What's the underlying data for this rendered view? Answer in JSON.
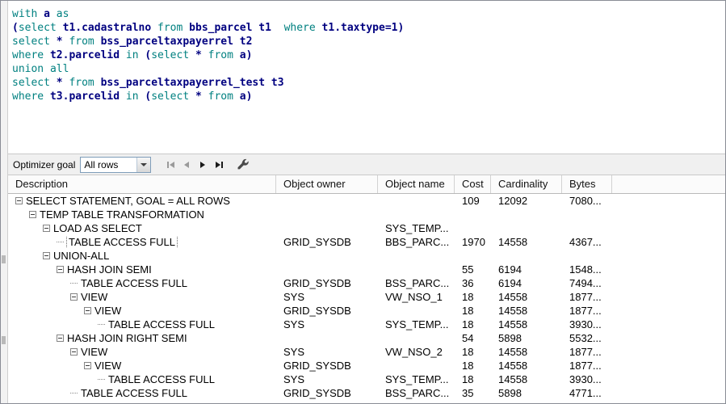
{
  "editor": {
    "lines": [
      [
        {
          "t": "with ",
          "k": "kw"
        },
        {
          "t": "a ",
          "k": "id"
        },
        {
          "t": "as",
          "k": "kw"
        }
      ],
      [
        {
          "t": "(",
          "k": "id"
        },
        {
          "t": "select ",
          "k": "kw"
        },
        {
          "t": "t1.cadastralno ",
          "k": "id"
        },
        {
          "t": "from ",
          "k": "kw"
        },
        {
          "t": "bbs_parcel t1  ",
          "k": "id"
        },
        {
          "t": "where ",
          "k": "kw"
        },
        {
          "t": "t1.taxtype=1)",
          "k": "id"
        }
      ],
      [
        {
          "t": "select ",
          "k": "kw"
        },
        {
          "t": "* ",
          "k": "id"
        },
        {
          "t": "from ",
          "k": "kw"
        },
        {
          "t": "bss_parceltaxpayerrel t2",
          "k": "id"
        }
      ],
      [
        {
          "t": "where ",
          "k": "kw"
        },
        {
          "t": "t2.parcelid ",
          "k": "id"
        },
        {
          "t": "in ",
          "k": "kw"
        },
        {
          "t": "(",
          "k": "id"
        },
        {
          "t": "select ",
          "k": "kw"
        },
        {
          "t": "* ",
          "k": "id"
        },
        {
          "t": "from ",
          "k": "kw"
        },
        {
          "t": "a)",
          "k": "id"
        }
      ],
      [
        {
          "t": "union all",
          "k": "kw"
        }
      ],
      [
        {
          "t": "select ",
          "k": "kw"
        },
        {
          "t": "* ",
          "k": "id"
        },
        {
          "t": "from ",
          "k": "kw"
        },
        {
          "t": "bss_parceltaxpayerrel_test t3",
          "k": "id"
        }
      ],
      [
        {
          "t": "where ",
          "k": "kw"
        },
        {
          "t": "t3.parcelid ",
          "k": "id"
        },
        {
          "t": "in ",
          "k": "kw"
        },
        {
          "t": "(",
          "k": "id"
        },
        {
          "t": "select ",
          "k": "kw"
        },
        {
          "t": "* ",
          "k": "id"
        },
        {
          "t": "from ",
          "k": "kw"
        },
        {
          "t": "a)",
          "k": "id"
        }
      ]
    ]
  },
  "toolbar": {
    "optimizer_goal_label": "Optimizer goal",
    "goal_value": "All rows",
    "icons": [
      "first-icon",
      "previous-icon",
      "next-icon",
      "last-icon",
      "wrench-icon",
      "chevron-down-icon"
    ]
  },
  "plan": {
    "columns": [
      "Description",
      "Object owner",
      "Object name",
      "Cost",
      "Cardinality",
      "Bytes"
    ],
    "rows": [
      {
        "level": 0,
        "box": true,
        "desc": "SELECT STATEMENT, GOAL = ALL ROWS",
        "owner": "",
        "name": "",
        "cost": "109",
        "card": "12092",
        "bytes": "7080..."
      },
      {
        "level": 1,
        "box": true,
        "desc": "TEMP TABLE TRANSFORMATION",
        "owner": "",
        "name": "",
        "cost": "",
        "card": "",
        "bytes": ""
      },
      {
        "level": 2,
        "box": true,
        "desc": "LOAD AS SELECT",
        "owner": "",
        "name": "SYS_TEMP...",
        "cost": "",
        "card": "",
        "bytes": ""
      },
      {
        "level": 3,
        "box": false,
        "focused": true,
        "desc": "TABLE ACCESS FULL",
        "owner": "GRID_SYSDB",
        "name": "BBS_PARC...",
        "cost": "1970",
        "card": "14558",
        "bytes": "4367..."
      },
      {
        "level": 2,
        "box": true,
        "desc": "UNION-ALL",
        "owner": "",
        "name": "",
        "cost": "",
        "card": "",
        "bytes": ""
      },
      {
        "level": 3,
        "box": true,
        "desc": "HASH JOIN SEMI",
        "owner": "",
        "name": "",
        "cost": "55",
        "card": "6194",
        "bytes": "1548..."
      },
      {
        "level": 4,
        "box": false,
        "desc": "TABLE ACCESS FULL",
        "owner": "GRID_SYSDB",
        "name": "BSS_PARC...",
        "cost": "36",
        "card": "6194",
        "bytes": "7494..."
      },
      {
        "level": 4,
        "box": true,
        "desc": "VIEW",
        "owner": "SYS",
        "name": "VW_NSO_1",
        "cost": "18",
        "card": "14558",
        "bytes": "1877..."
      },
      {
        "level": 5,
        "box": true,
        "desc": "VIEW",
        "owner": "GRID_SYSDB",
        "name": "",
        "cost": "18",
        "card": "14558",
        "bytes": "1877..."
      },
      {
        "level": 6,
        "box": false,
        "desc": "TABLE ACCESS FULL",
        "owner": "SYS",
        "name": "SYS_TEMP...",
        "cost": "18",
        "card": "14558",
        "bytes": "3930..."
      },
      {
        "level": 3,
        "box": true,
        "desc": "HASH JOIN RIGHT SEMI",
        "owner": "",
        "name": "",
        "cost": "54",
        "card": "5898",
        "bytes": "5532..."
      },
      {
        "level": 4,
        "box": true,
        "desc": "VIEW",
        "owner": "SYS",
        "name": "VW_NSO_2",
        "cost": "18",
        "card": "14558",
        "bytes": "1877..."
      },
      {
        "level": 5,
        "box": true,
        "desc": "VIEW",
        "owner": "GRID_SYSDB",
        "name": "",
        "cost": "18",
        "card": "14558",
        "bytes": "1877..."
      },
      {
        "level": 6,
        "box": false,
        "desc": "TABLE ACCESS FULL",
        "owner": "SYS",
        "name": "SYS_TEMP...",
        "cost": "18",
        "card": "14558",
        "bytes": "3930..."
      },
      {
        "level": 4,
        "box": false,
        "desc": "TABLE ACCESS FULL",
        "owner": "GRID_SYSDB",
        "name": "BSS_PARC...",
        "cost": "35",
        "card": "5898",
        "bytes": "4771..."
      }
    ]
  }
}
